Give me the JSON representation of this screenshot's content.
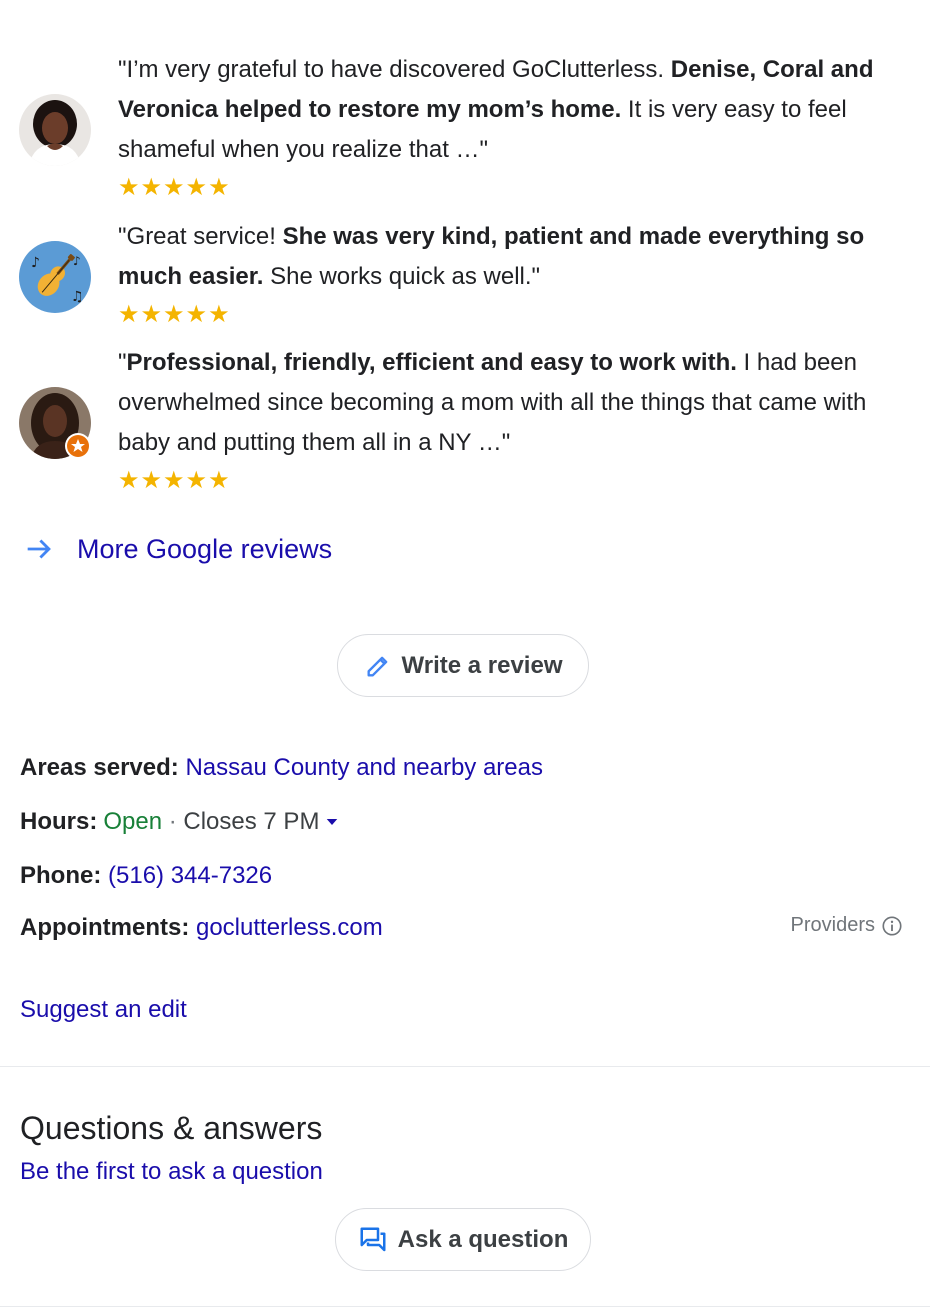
{
  "reviews": [
    {
      "text_before": "\"I’m very grateful to have discovered GoClutterless. ",
      "text_bold": "Denise, Coral and Veronica helped to restore my mom’s home.",
      "text_after": " It is very easy to feel shameful when you realize that …\"",
      "stars": "★★★★★"
    },
    {
      "text_before": "\"Great service! ",
      "text_bold": "She was very kind, patient and made everything so much easier.",
      "text_after": " She works quick as well.\"",
      "stars": "★★★★★"
    },
    {
      "text_before": "\"",
      "text_bold": "Professional, friendly, efficient and easy to work with.",
      "text_after": " I had been overwhelmed since becoming a mom with all the things that came with baby and putting them all in a NY …\"",
      "stars": "★★★★★"
    }
  ],
  "more_reviews_label": "More Google reviews",
  "write_review_label": "Write a review",
  "info": {
    "areas_label": "Areas served:",
    "areas_value": "Nassau County and nearby areas",
    "hours_label": "Hours:",
    "hours_status": "Open",
    "hours_separator": " · ",
    "hours_closes": "Closes 7 PM",
    "phone_label": "Phone:",
    "phone_value": "(516) 344-7326",
    "appointments_label": "Appointments:",
    "appointments_value": "goclutterless.com",
    "providers_label": "Providers"
  },
  "suggest_edit_label": "Suggest an edit",
  "qa": {
    "title": "Questions & answers",
    "first_question_link": "Be the first to ask a question",
    "ask_button_label": "Ask a question"
  },
  "colors": {
    "link": "#1a0dab",
    "open": "#188038",
    "star": "#f4b400",
    "icon_blue": "#4285f4"
  },
  "icons": [
    "arrow-right-icon",
    "pencil-icon",
    "chevron-down-icon",
    "info-icon",
    "question-answer-icon",
    "local-guide-badge-icon"
  ]
}
